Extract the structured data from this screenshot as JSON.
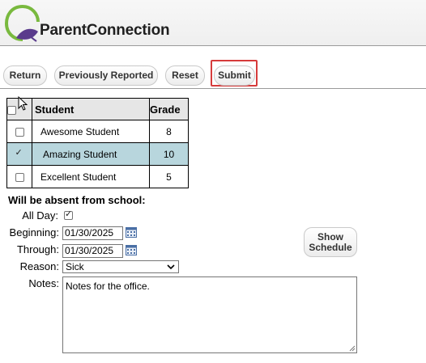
{
  "brand": {
    "name": "ParentConnection"
  },
  "toolbar": {
    "return_label": "Return",
    "previously_reported_label": "Previously Reported",
    "reset_label": "Reset",
    "submit_label": "Submit"
  },
  "table": {
    "headers": {
      "student": "Student",
      "grade": "Grade"
    },
    "rows": [
      {
        "name": "Awesome Student",
        "grade": "8",
        "checked": false
      },
      {
        "name": "Amazing Student",
        "grade": "10",
        "checked": true
      },
      {
        "name": "Excellent Student",
        "grade": "5",
        "checked": false
      }
    ]
  },
  "absence": {
    "title": "Will be absent from school:",
    "all_day_label": "All Day:",
    "all_day_checked": true,
    "beginning_label": "Beginning:",
    "beginning_value": "01/30/2025",
    "through_label": "Through:",
    "through_value": "01/30/2025",
    "reason_label": "Reason:",
    "reason_value": "Sick",
    "notes_label": "Notes:",
    "notes_value": "Notes for the office.",
    "show_schedule_label_1": "Show",
    "show_schedule_label_2": "Schedule"
  },
  "icons": {
    "logo": "q-logo-icon",
    "calendar": "calendar-icon",
    "dropdown": "chevron-down-icon"
  },
  "colors": {
    "selected_row": "#b8d6dd",
    "focus_ring": "#d63b3b",
    "logo_green": "#79b93e",
    "logo_purple": "#5a3b8c"
  }
}
